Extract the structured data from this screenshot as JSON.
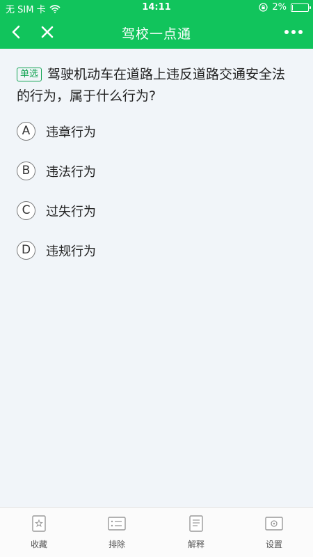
{
  "status_bar": {
    "carrier": "无 SIM 卡",
    "time": "14:11",
    "battery": "2%"
  },
  "nav": {
    "title": "驾校一点通"
  },
  "question": {
    "type_badge": "单选",
    "text": "驾驶机动车在道路上违反道路交通安全法的行为，属于什么行为?",
    "options": [
      {
        "letter": "A",
        "text": "违章行为"
      },
      {
        "letter": "B",
        "text": "违法行为"
      },
      {
        "letter": "C",
        "text": "过失行为"
      },
      {
        "letter": "D",
        "text": "违规行为"
      }
    ]
  },
  "bottom_tabs": [
    {
      "label": "收藏",
      "icon": "star-icon"
    },
    {
      "label": "排除",
      "icon": "exclude-list-icon"
    },
    {
      "label": "解释",
      "icon": "explanation-doc-icon"
    },
    {
      "label": "设置",
      "icon": "settings-icon"
    }
  ],
  "colors": {
    "brand_green": "#11c45c",
    "page_background": "#f1f5f9"
  }
}
